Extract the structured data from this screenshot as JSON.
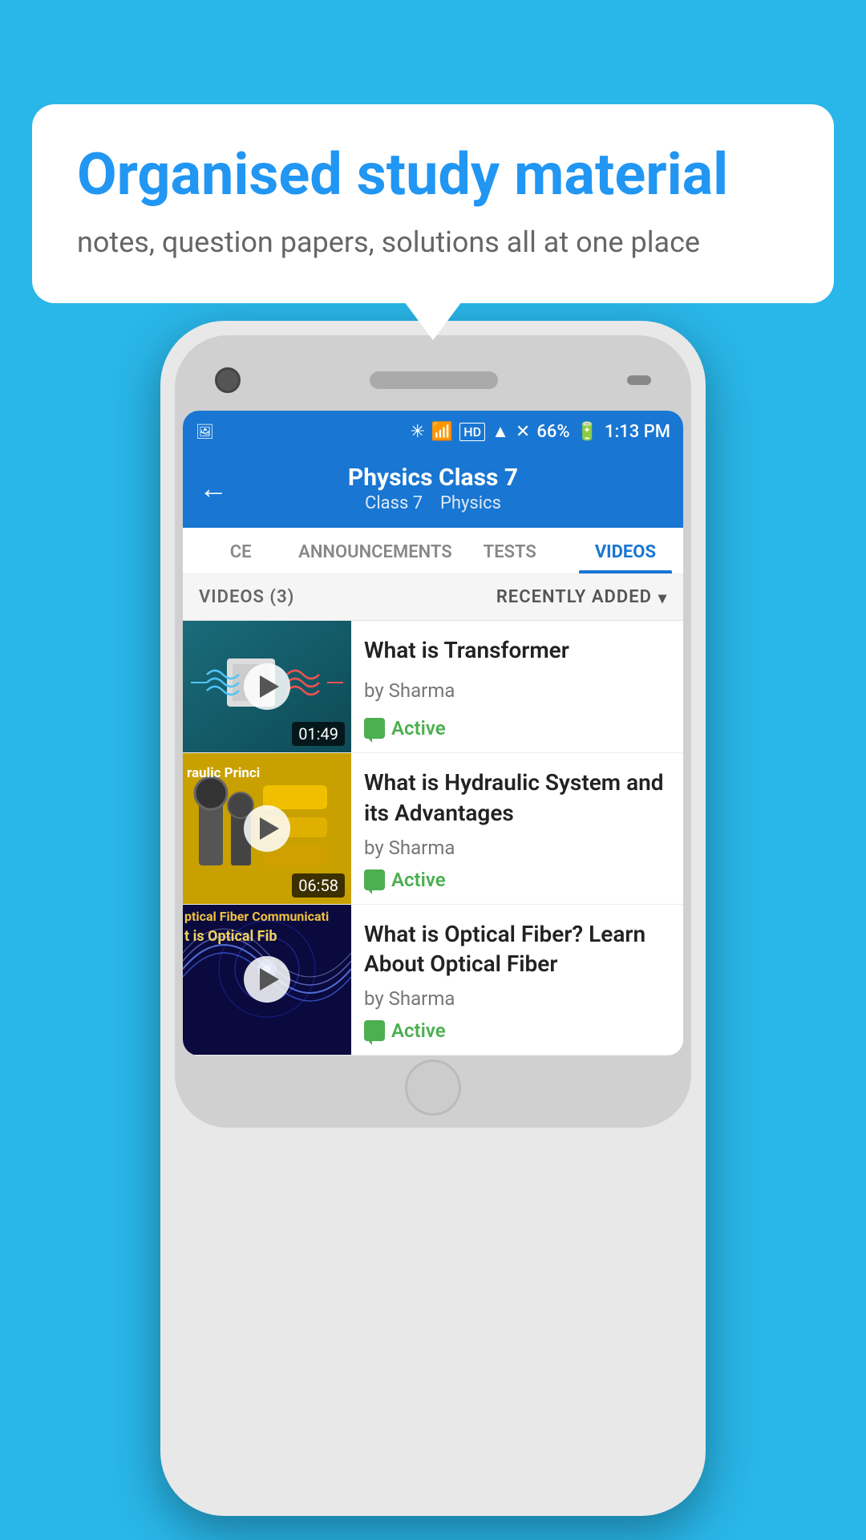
{
  "background_color": "#29b6e8",
  "speech_bubble": {
    "title": "Organised study material",
    "subtitle": "notes, question papers, solutions all at one place"
  },
  "status_bar": {
    "time": "1:13 PM",
    "battery": "66%",
    "signal_icons": "📶"
  },
  "app_bar": {
    "title": "Physics Class 7",
    "subtitle_class": "Class 7",
    "subtitle_subject": "Physics",
    "back_label": "←"
  },
  "tabs": [
    {
      "id": "ce",
      "label": "CE",
      "active": false
    },
    {
      "id": "announcements",
      "label": "ANNOUNCEMENTS",
      "active": false
    },
    {
      "id": "tests",
      "label": "TESTS",
      "active": false
    },
    {
      "id": "videos",
      "label": "VIDEOS",
      "active": true
    }
  ],
  "videos_section": {
    "count_label": "VIDEOS (3)",
    "sort_label": "RECENTLY ADDED"
  },
  "videos": [
    {
      "id": 1,
      "title": "What is  Transformer",
      "author": "by Sharma",
      "status": "Active",
      "duration": "01:49",
      "thumb_type": "transformer"
    },
    {
      "id": 2,
      "title": "What is Hydraulic System and its Advantages",
      "author": "by Sharma",
      "status": "Active",
      "duration": "06:58",
      "thumb_type": "hydraulic",
      "thumb_text_line1": "raulic Princi",
      "thumb_text_line2": ""
    },
    {
      "id": 3,
      "title": "What is Optical Fiber? Learn About Optical Fiber",
      "author": "by Sharma",
      "status": "Active",
      "duration": "",
      "thumb_type": "optical",
      "thumb_text_line1": "ptical Fiber Communicati",
      "thumb_text_line2": "t is Optical Fib"
    }
  ]
}
